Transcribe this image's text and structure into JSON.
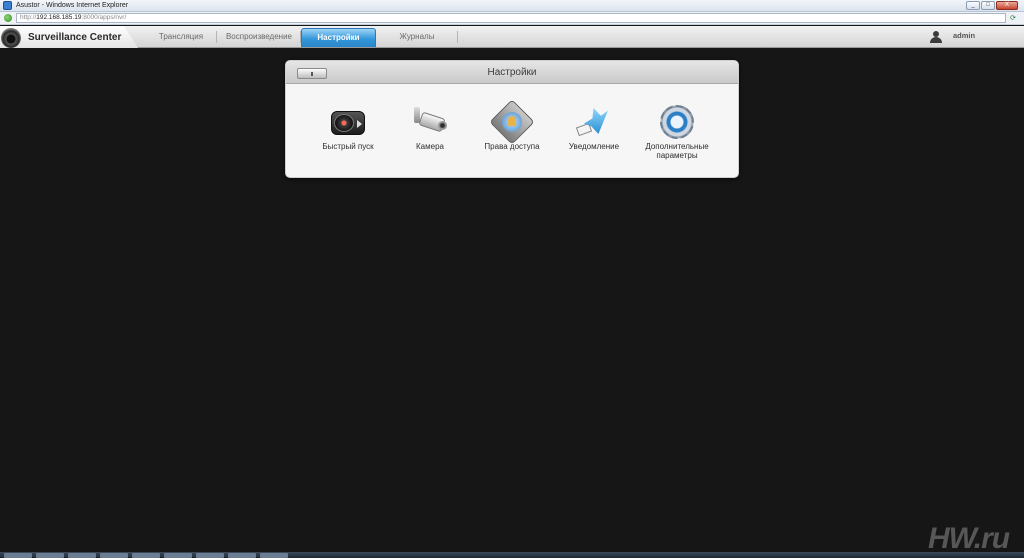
{
  "window": {
    "title": "Asustor - Windows Internet Explorer",
    "controls": [
      "_",
      "□",
      "X"
    ]
  },
  "address_bar": {
    "url_prefix": "http://",
    "url_host": "192.168.185.19",
    "url_rest": ":8000/apps/nvr/"
  },
  "app": {
    "logo_text": "Surveillance Center",
    "tabs": [
      {
        "label": "Трансляция",
        "active": false
      },
      {
        "label": "Воспроизведение",
        "active": false
      },
      {
        "label": "Настройки",
        "active": true
      },
      {
        "label": "Журналы",
        "active": false
      }
    ],
    "user": "admin"
  },
  "settings_panel": {
    "title": "Настройки",
    "items": [
      {
        "label": "Быстрый пуск",
        "icon": "gauge-icon"
      },
      {
        "label": "Камера",
        "icon": "camera-icon"
      },
      {
        "label": "Права доступа",
        "icon": "access-rights-icon"
      },
      {
        "label": "Уведомление",
        "icon": "notification-bird-icon"
      },
      {
        "label": "Дополнительные параметры",
        "icon": "gear-icon"
      }
    ]
  },
  "watermark": "HW.ru",
  "colors": {
    "active_tab": "#3497db",
    "background": "#161616",
    "panel_bg": "#f6f6f6"
  }
}
